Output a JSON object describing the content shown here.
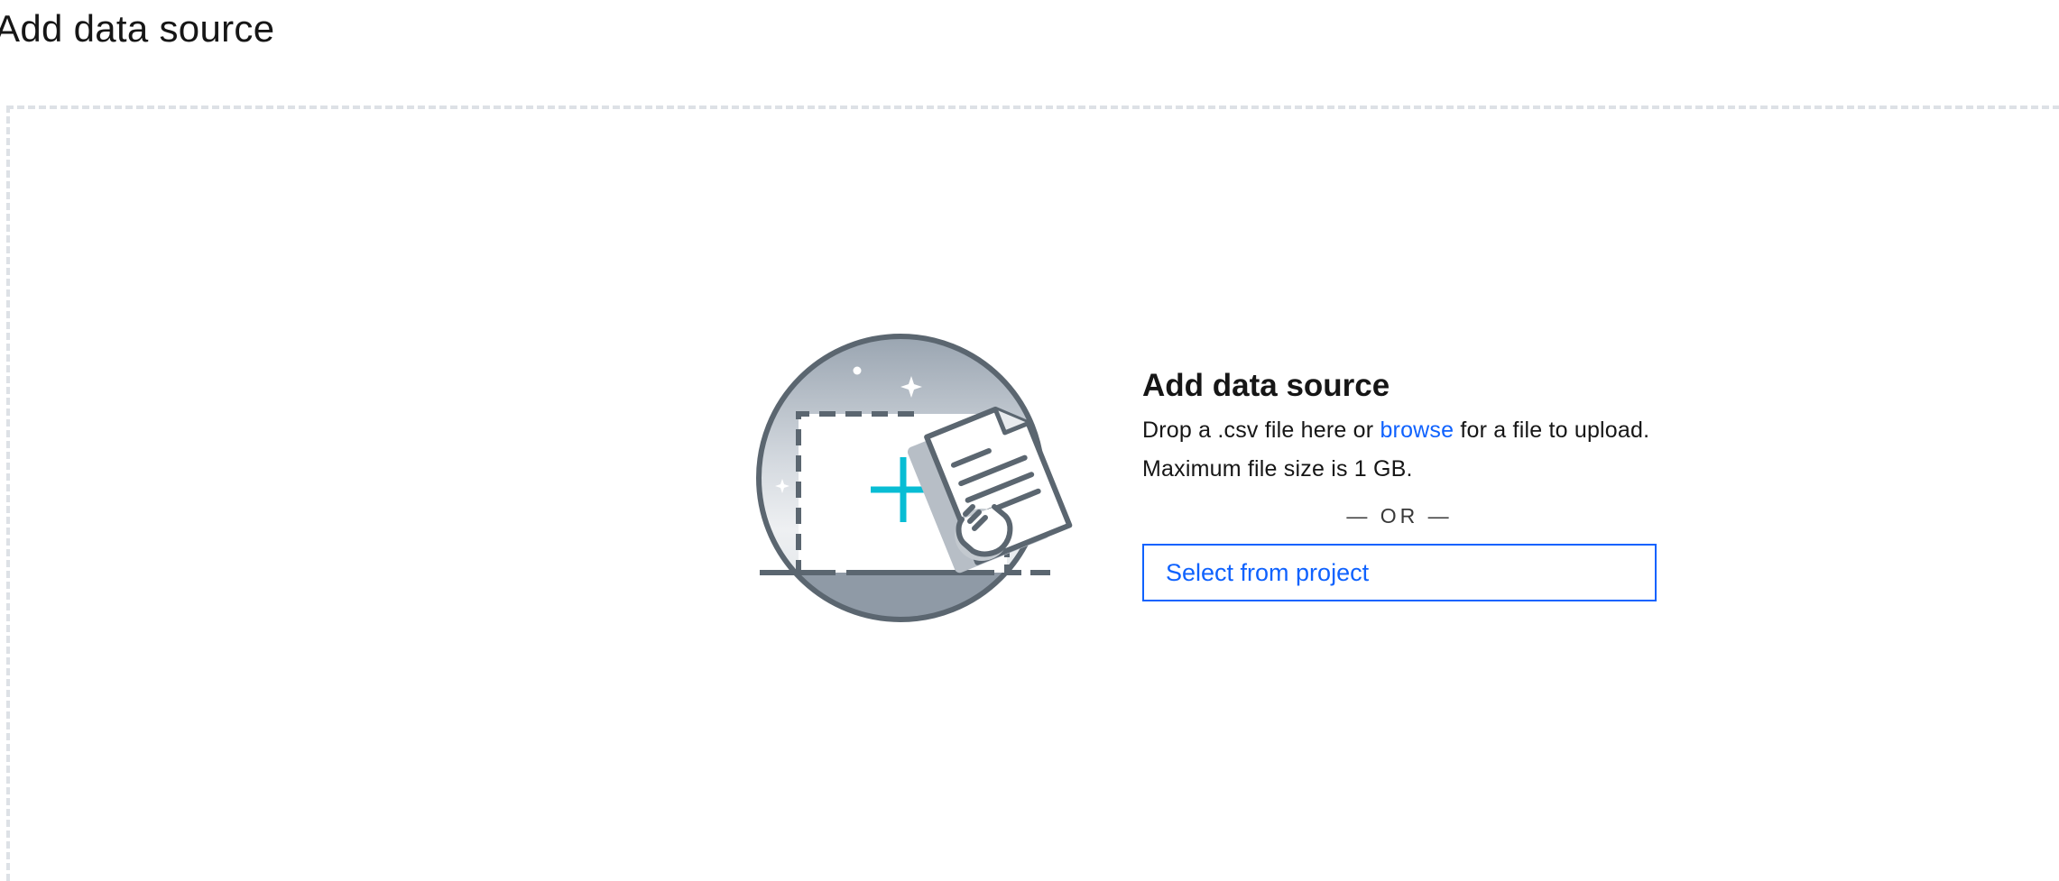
{
  "page": {
    "title": "Add data source"
  },
  "dropzone": {
    "heading": "Add data source",
    "desc_before": "Drop a .csv file here or ",
    "browse_label": "browse",
    "desc_after": " for a file to upload. Maximum file size is 1 GB.",
    "or_label": "— OR —",
    "select_button_label": "Select from project",
    "illustration_icon": "upload-file-icon"
  },
  "colors": {
    "link": "#0f62fe",
    "plus_accent": "#08bdd4",
    "illustration_stroke": "#5b6670",
    "dashed_border": "#dde1e6"
  }
}
